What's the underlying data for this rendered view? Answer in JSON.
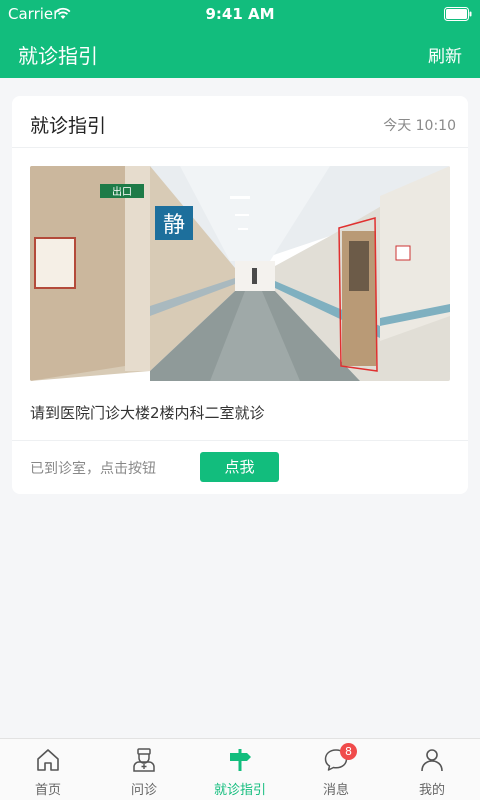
{
  "status_bar": {
    "carrier": "Carrier",
    "time": "9:41 AM"
  },
  "nav": {
    "title": "就诊指引",
    "refresh_label": "刷新"
  },
  "card": {
    "title": "就诊指引",
    "time": "今天 10:10",
    "instruction": "请到医院门诊大楼2楼内科二室就诊",
    "prompt": "已到诊室，点击按钮",
    "button_label": "点我",
    "photo_sign_text": "静",
    "photo_exit_text": "出口"
  },
  "tabbar": {
    "items": [
      {
        "label": "首页",
        "icon": "home-icon"
      },
      {
        "label": "问诊",
        "icon": "doctor-icon"
      },
      {
        "label": "就诊指引",
        "icon": "signpost-icon",
        "active": true
      },
      {
        "label": "消息",
        "icon": "chat-icon",
        "badge": "8"
      },
      {
        "label": "我的",
        "icon": "user-icon"
      }
    ]
  },
  "colors": {
    "accent": "#12bd7d",
    "badge": "#f04b4b"
  }
}
